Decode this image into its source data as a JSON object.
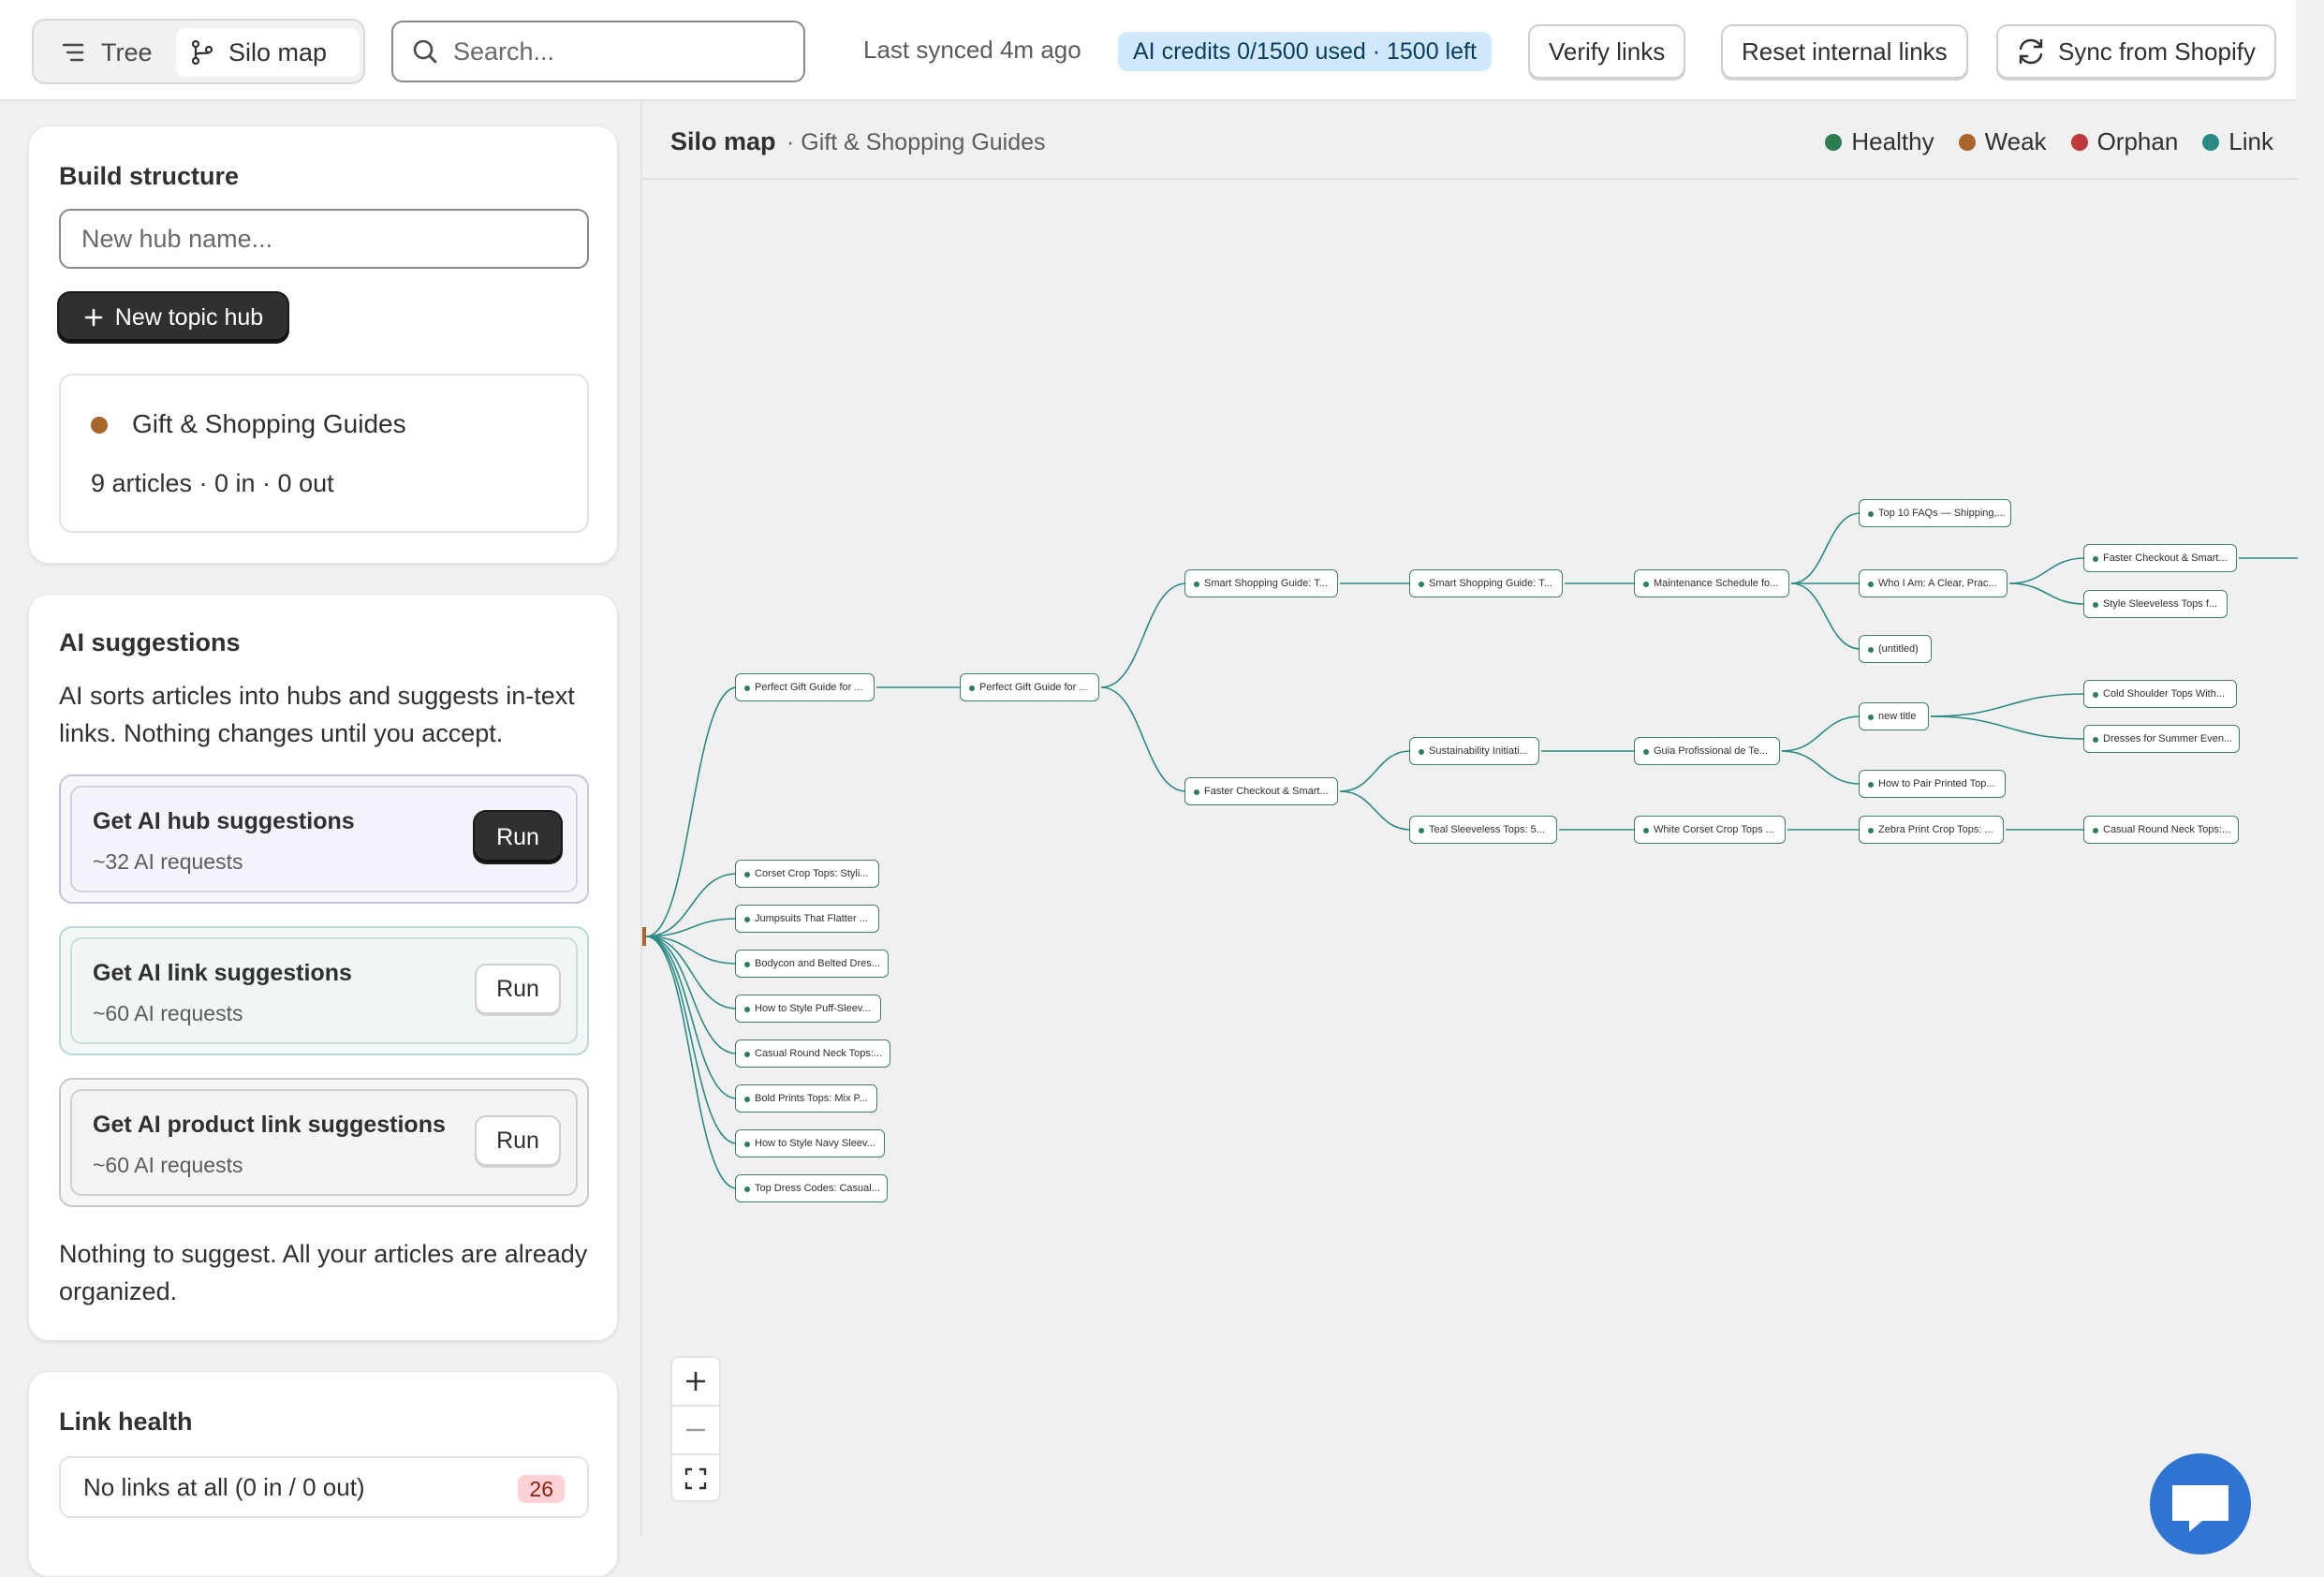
{
  "header": {
    "view_toggle": {
      "tree": "Tree",
      "silo": "Silo map"
    },
    "search_placeholder": "Search...",
    "last_synced": "Last synced 4m ago",
    "credits": "AI credits 0/1500 used · 1500 left",
    "verify_links": "Verify links",
    "reset_links": "Reset internal links",
    "sync_shopify": "Sync from Shopify"
  },
  "build": {
    "title": "Build structure",
    "hub_placeholder": "New hub name...",
    "new_hub_button": "New topic hub",
    "hub": {
      "name": "Gift & Shopping Guides",
      "stats": "9 articles · 0 in · 0 out",
      "status_color": "#a8662a"
    }
  },
  "ai": {
    "title": "AI suggestions",
    "description": "AI sorts articles into hubs and suggests in-text links. Nothing changes until you accept.",
    "items": [
      {
        "title": "Get AI hub suggestions",
        "sub": "~32 AI requests",
        "run": "Run"
      },
      {
        "title": "Get AI link suggestions",
        "sub": "~60 AI requests",
        "run": "Run"
      },
      {
        "title": "Get AI product link suggestions",
        "sub": "~60 AI requests",
        "run": "Run"
      }
    ],
    "empty": "Nothing to suggest. All your articles are already organized."
  },
  "health": {
    "title": "Link health",
    "row": {
      "label": "No links at all (0 in / 0 out)",
      "count": "26"
    }
  },
  "map": {
    "title": "Silo map",
    "subtitle": "· Gift & Shopping Guides",
    "legend": [
      {
        "label": "Healthy",
        "color": "#2e7d4f"
      },
      {
        "label": "Weak",
        "color": "#a8662a"
      },
      {
        "label": "Orphan",
        "color": "#c0393b"
      },
      {
        "label": "Link",
        "color": "#2a8a84"
      }
    ],
    "nodes": {
      "n1": "Perfect Gift Guide for ...",
      "n2": "Perfect Gift Guide for ...",
      "n3": "Smart Shopping Guide: T...",
      "n4": "Smart Shopping Guide: T...",
      "n5": "Maintenance Schedule fo...",
      "n6": "Top 10 FAQs — Shipping,...",
      "n7": "Who I Am: A Clear, Prac...",
      "n8": "Faster Checkout & Smart...",
      "n9": "Style Sleeveless Tops f...",
      "n10": "(untitled)",
      "n11": "Faster Checkout & Smart...",
      "n12": "Sustainability Initiati...",
      "n13": "Guia Profissional de Te...",
      "n14": "new title",
      "n15": "Cold Shoulder Tops With...",
      "n16": "Dresses for Summer Even...",
      "n17": "How to Pair Printed Top...",
      "n18": "Teal Sleeveless Tops: 5...",
      "n19": "White Corset Crop Tops ...",
      "n20": "Zebra Print Crop Tops: ...",
      "n21": "Casual Round Neck Tops:...",
      "l1": "Corset Crop Tops: Styli...",
      "l2": "Jumpsuits That Flatter ...",
      "l3": "Bodycon and Belted Dres...",
      "l4": "How to Style Puff-Sleev...",
      "l5": "Casual Round Neck Tops:...",
      "l6": "Bold Prints Tops: Mix P...",
      "l7": "How to Style Navy Sleev...",
      "l8": "Top Dress Codes: Casual..."
    }
  }
}
